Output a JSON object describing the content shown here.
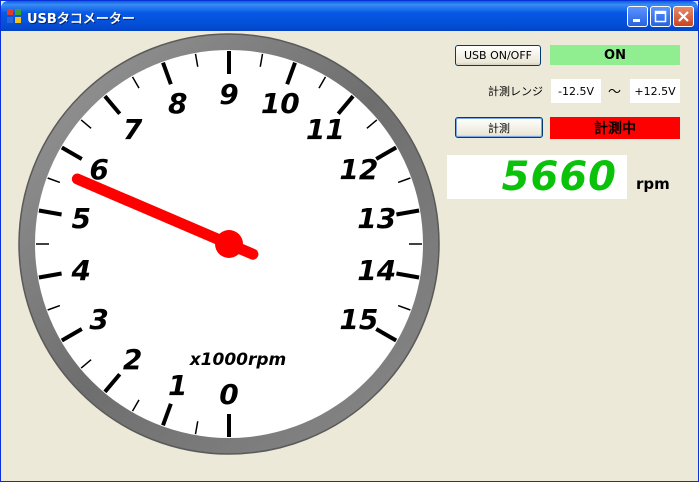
{
  "window": {
    "title": "USBタコメーター",
    "icon": "app-icon"
  },
  "titlebar_buttons": [
    "minimize-icon",
    "maximize-icon",
    "close-icon"
  ],
  "gauge": {
    "tick_labels": [
      "0",
      "1",
      "2",
      "3",
      "4",
      "5",
      "6",
      "7",
      "8",
      "9",
      "10",
      "11",
      "12",
      "13",
      "14",
      "15"
    ],
    "unit_label": "x1000rpm",
    "needle_value_krpm": 5.66,
    "scale_max_krpm": 15,
    "colors": {
      "bezel": "#7a7a7a",
      "face": "#ffffff",
      "needle": "#ff0000",
      "text": "#000000"
    }
  },
  "controls": {
    "usb_button_label": "USB ON/OFF",
    "usb_status": "ON",
    "usb_status_color": "#90ee90",
    "range_label": "計測レンジ",
    "range_min": "-12.5V",
    "range_separator": "〜",
    "range_max": "+12.5V",
    "measure_button_label": "計測",
    "measure_status": "計測中",
    "measure_status_color": "#ff0000"
  },
  "readout": {
    "value": "5660",
    "unit": "rpm",
    "color": "#0bc20b"
  }
}
